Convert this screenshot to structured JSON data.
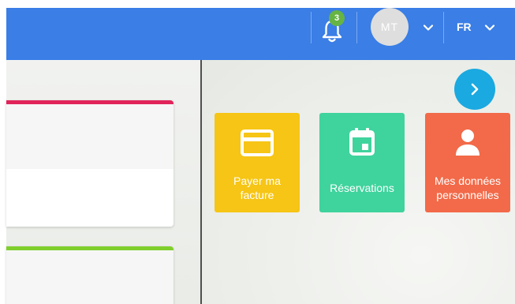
{
  "header": {
    "notifications": {
      "icon": "bell-icon",
      "count": "3"
    },
    "user": {
      "initials": "MT",
      "menu_icon": "chevron-down-icon"
    },
    "language": {
      "label": "FR",
      "menu_icon": "chevron-down-icon"
    }
  },
  "main": {
    "next_button_icon": "chevron-right-icon",
    "tiles": [
      {
        "label": "Payer ma facture",
        "icon": "credit-card-icon",
        "color": "#f6c515"
      },
      {
        "label": "Réservations",
        "icon": "calendar-icon",
        "color": "#3fd39d"
      },
      {
        "label": "Mes données personnelles",
        "icon": "person-icon",
        "color": "#f26a49"
      }
    ],
    "cards": [
      {
        "accent": "#e0245a"
      },
      {
        "accent": "#7fcf2c"
      }
    ]
  },
  "colors": {
    "header": "#3a7ee6",
    "badge": "#66b443",
    "next_button": "#1aa9e0"
  }
}
